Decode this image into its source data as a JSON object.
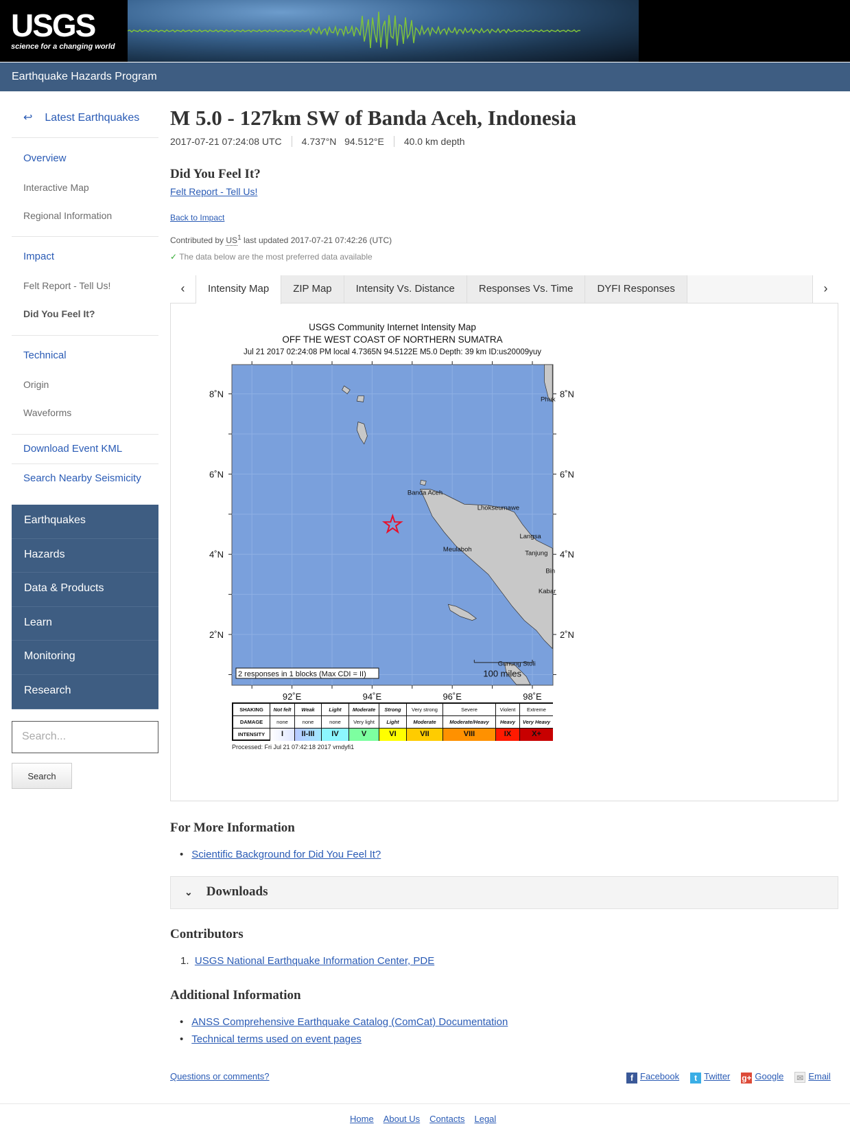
{
  "header": {
    "logo": "USGS",
    "tagline": "science for a changing world",
    "program": "Earthquake Hazards Program"
  },
  "sidebar": {
    "back": "Latest Earthquakes",
    "sections": [
      {
        "title": "Overview",
        "items": [
          "Interactive Map",
          "Regional Information"
        ]
      },
      {
        "title": "Impact",
        "items": [
          "Felt Report - Tell Us!",
          "Did You Feel It?"
        ]
      },
      {
        "title": "Technical",
        "items": [
          "Origin",
          "Waveforms"
        ]
      }
    ],
    "links": [
      "Download Event KML",
      "Search Nearby Seismicity"
    ],
    "nav": [
      "Earthquakes",
      "Hazards",
      "Data & Products",
      "Learn",
      "Monitoring",
      "Research"
    ],
    "search_placeholder": "Search...",
    "search_button": "Search"
  },
  "event": {
    "title": "M 5.0 - 127km SW of Banda Aceh, Indonesia",
    "time": "2017-07-21 07:24:08 UTC",
    "coords": "4.737°N   94.512°E",
    "depth": "40.0 km depth"
  },
  "dyfi": {
    "heading": "Did You Feel It?",
    "felt_link": "Felt Report - Tell Us!",
    "back_link": "Back to Impact",
    "contributed_prefix": "Contributed by",
    "contributor": "US",
    "contributor_sup": "1",
    "updated": "last updated 2017-07-21 07:42:26 (UTC)",
    "preferred": "The data below are the most preferred data available"
  },
  "tabs": {
    "items": [
      "Intensity Map",
      "ZIP Map",
      "Intensity Vs. Distance",
      "Responses Vs. Time",
      "DYFI Responses"
    ],
    "active": 0
  },
  "map": {
    "title": "USGS Community Internet Intensity Map",
    "region": "OFF THE WEST COAST OF NORTHERN SUMATRA",
    "subtitle": "Jul 21 2017 02:24:08 PM local 4.7365N 94.5122E M5.0 Depth: 39 km ID:us20009yuy",
    "epicenter": {
      "lat": 4.7365,
      "lon": 94.5122
    },
    "lon_ticks": [
      "92˚E",
      "94˚E",
      "96˚E",
      "98˚E"
    ],
    "lat_ticks": [
      "8˚N",
      "6˚N",
      "4˚N",
      "2˚N"
    ],
    "cities": [
      {
        "name": "Banda Aceh",
        "lat": 5.55,
        "lon": 95.32
      },
      {
        "name": "Lhokseumawe",
        "lat": 5.18,
        "lon": 97.15
      },
      {
        "name": "Langsa",
        "lat": 4.47,
        "lon": 97.95
      },
      {
        "name": "Meulaboh",
        "lat": 4.14,
        "lon": 96.13
      },
      {
        "name": "Tanjung",
        "lat": 4.05,
        "lon": 98.1
      },
      {
        "name": "Bin",
        "lat": 3.6,
        "lon": 98.45
      },
      {
        "name": "Kabar",
        "lat": 3.1,
        "lon": 98.37
      },
      {
        "name": "Phuk",
        "lat": 7.88,
        "lon": 98.39
      },
      {
        "name": "Gunung Stoli",
        "lat": 1.29,
        "lon": 97.61
      }
    ],
    "responses_note": "2 responses in 1 blocks (Max CDI = II)",
    "scale": "100 miles",
    "water_color": "#7aa0dc",
    "land_color": "#c8c8c8",
    "legend": {
      "row_labels": [
        "SHAKING",
        "DAMAGE",
        "INTENSITY"
      ],
      "shaking": [
        "Not felt",
        "Weak",
        "Light",
        "Moderate",
        "Strong",
        "Very strong",
        "Severe",
        "Violent",
        "Extreme"
      ],
      "damage": [
        "none",
        "none",
        "none",
        "Very light",
        "Light",
        "Moderate",
        "Moderate/Heavy",
        "Heavy",
        "Very Heavy"
      ],
      "intensity": [
        "I",
        "II-III",
        "IV",
        "V",
        "VI",
        "VII",
        "VIII",
        "IX",
        "X+"
      ],
      "colors": [
        "#ffffff",
        "#b8d4ff",
        "#8cf6ff",
        "#7dffa0",
        "#ffff00",
        "#ffcc00",
        "#ff9100",
        "#ff1a00",
        "#c80000"
      ]
    },
    "processed": "Processed: Fri Jul 21 07:42:18 2017 vmdyfi1"
  },
  "more_info": {
    "heading": "For More Information",
    "links": [
      "Scientific Background for Did You Feel It?"
    ]
  },
  "downloads": "Downloads",
  "contributors": {
    "heading": "Contributors",
    "items": [
      "USGS National Earthquake Information Center, PDE"
    ]
  },
  "additional": {
    "heading": "Additional Information",
    "links": [
      "ANSS Comprehensive Earthquake Catalog (ComCat) Documentation",
      "Technical terms used on event pages"
    ]
  },
  "footer": {
    "questions": "Questions or comments?",
    "share": [
      "Facebook",
      "Twitter",
      "Google",
      "Email"
    ],
    "links": [
      "Home",
      "About Us",
      "Contacts",
      "Legal"
    ]
  }
}
